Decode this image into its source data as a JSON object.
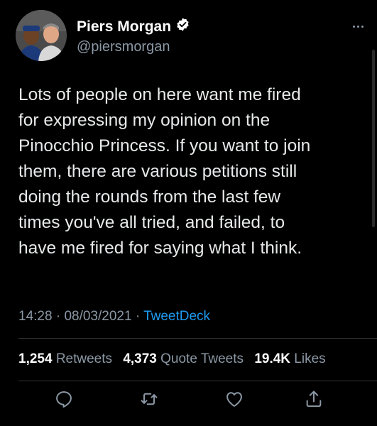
{
  "user": {
    "display_name": "Piers Morgan",
    "handle": "@piersmorgan",
    "verified": true
  },
  "tweet": {
    "text": "Lots of people on here want me fired\nfor expressing my opinion on the\nPinocchio Princess. If you want to join\nthem, there are various petitions still\ndoing the rounds from the last few\ntimes you've all tried, and failed, to\nhave me fired for saying what I think."
  },
  "meta": {
    "time": "14:28",
    "date": "08/03/2021",
    "separator": "·",
    "source": "TweetDeck"
  },
  "stats": {
    "retweets_count": "1,254",
    "retweets_label": "Retweets",
    "quote_count": "4,373",
    "quote_label": "Quote Tweets",
    "likes_count": "19.4K",
    "likes_label": "Likes"
  },
  "icons": {
    "verified": "verified-badge-icon",
    "more": "more-options-icon",
    "reply": "reply-icon",
    "retweet": "retweet-icon",
    "like": "heart-icon",
    "share": "share-icon"
  },
  "colors": {
    "background": "#000000",
    "primary_text": "#e7e9ea",
    "secondary_text": "#8b98a5",
    "link": "#1d9bf0",
    "divider": "#2f3336"
  }
}
